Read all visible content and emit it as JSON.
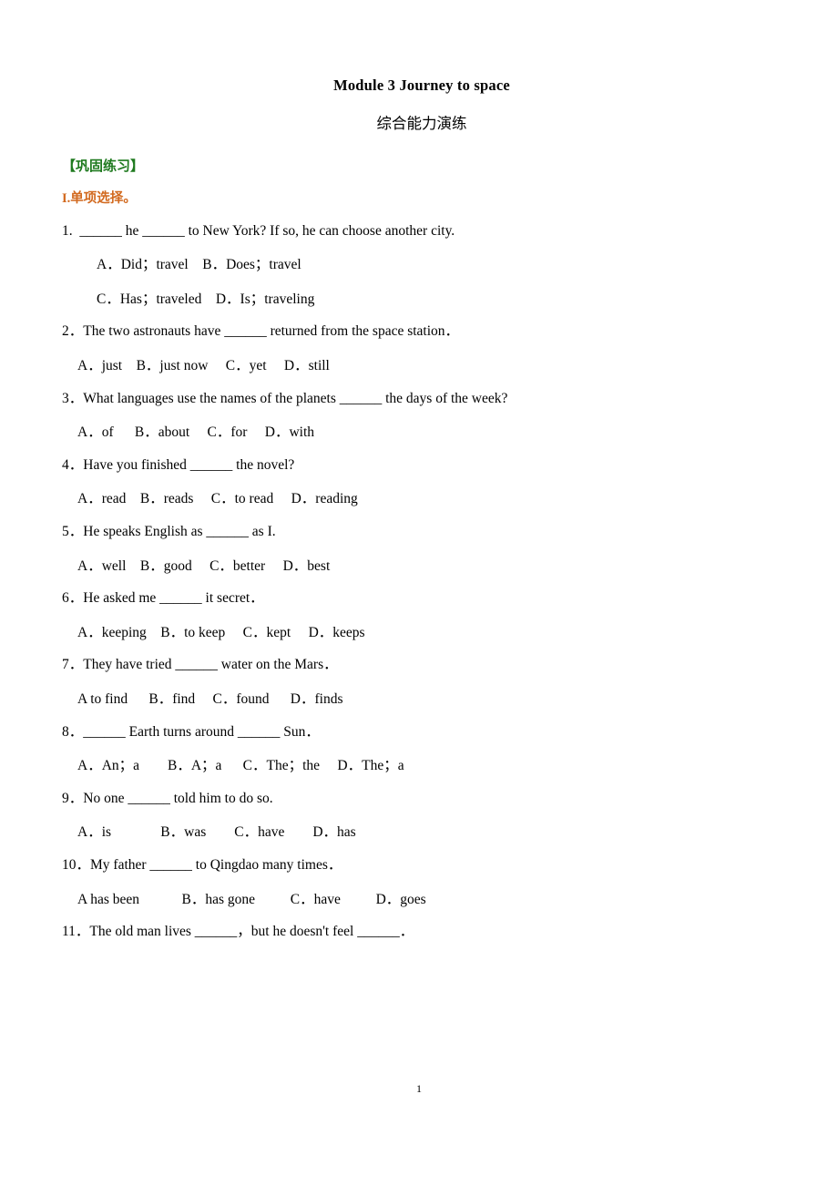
{
  "document": {
    "title": "Module 3 Journey to space",
    "subtitle": "综合能力演练",
    "page_number": "1"
  },
  "colors": {
    "section_bracket": "#1f7a1f",
    "section_roman": "#d2691e",
    "body_text": "#000000",
    "page_background": "#ffffff"
  },
  "sections": {
    "bracket_header": "【巩固练习】",
    "roman_number": "I.",
    "roman_label": "单项选择。"
  },
  "questions": [
    {
      "number": "1.",
      "stem_parts": [
        "1.  ",
        "BLANK",
        " he ",
        "BLANK",
        " to New York? If so, he can choose another city."
      ],
      "stem_text": "1.  ______ he ______ to New York? If so, he can choose another city.",
      "options_lines": [
        "A．Did；travel    B．Does；travel",
        "C．Has；traveled    D．Is；traveling"
      ],
      "options": [
        "A．Did；travel",
        "B．Does；travel",
        "C．Has；traveled",
        "D．Is；traveling"
      ]
    },
    {
      "number": "2.",
      "stem_text": "2．The two astronauts have ______ returned from the space station．",
      "options_lines": [
        "A．just    B．just now     C．yet     D．still"
      ],
      "options": [
        "A．just",
        "B．just now",
        "C．yet",
        "D．still"
      ]
    },
    {
      "number": "3.",
      "stem_text": "3．What languages use the names of the planets ______ the days of the week?",
      "options_lines": [
        "A．of      B．about     C．for     D．with"
      ],
      "options": [
        "A．of",
        "B．about",
        "C．for",
        "D．with"
      ]
    },
    {
      "number": "4.",
      "stem_text": "4．Have you finished ______ the novel?",
      "options_lines": [
        "A．read    B．reads     C．to read     D．reading"
      ],
      "options": [
        "A．read",
        "B．reads",
        "C．to read",
        "D．reading"
      ]
    },
    {
      "number": "5.",
      "stem_text": "5．He speaks English as ______ as I.",
      "options_lines": [
        "A．well    B．good     C．better     D．best"
      ],
      "options": [
        "A．well",
        "B．good",
        "C．better",
        "D．best"
      ]
    },
    {
      "number": "6.",
      "stem_text": "6．He asked me ______ it secret．",
      "options_lines": [
        "A．keeping    B．to keep     C．kept     D．keeps"
      ],
      "options": [
        "A．keeping",
        "B．to keep",
        "C．kept",
        "D．keeps"
      ]
    },
    {
      "number": "7.",
      "stem_text": "7．They have tried ______ water on the Mars．",
      "options_lines": [
        "A to find      B．find     C．found      D．finds"
      ],
      "options": [
        "A to find",
        "B．find",
        "C．found",
        "D．finds"
      ]
    },
    {
      "number": "8.",
      "stem_text": "8．______ Earth turns around ______ Sun．",
      "options_lines": [
        "A．An；a        B．A；a      C．The；the     D．The；a"
      ],
      "options": [
        "A．An；a",
        "B．A；a",
        "C．The；the",
        "D．The；a"
      ]
    },
    {
      "number": "9.",
      "stem_text": "9．No one ______ told him to do so.",
      "options_lines": [
        "A．is              B．was        C．have        D．has"
      ],
      "options": [
        "A．is",
        "B．was",
        "C．have",
        "D．has"
      ]
    },
    {
      "number": "10.",
      "stem_text": "10．My father ______ to Qingdao many times．",
      "options_lines": [
        "A has been            B．has gone          C．have          D．goes"
      ],
      "options": [
        "A has been",
        "B．has gone",
        "C．have",
        "D．goes"
      ]
    },
    {
      "number": "11.",
      "stem_text": "11．The old man lives ______，but he doesn't feel ______．",
      "options_lines": [],
      "options": []
    }
  ]
}
